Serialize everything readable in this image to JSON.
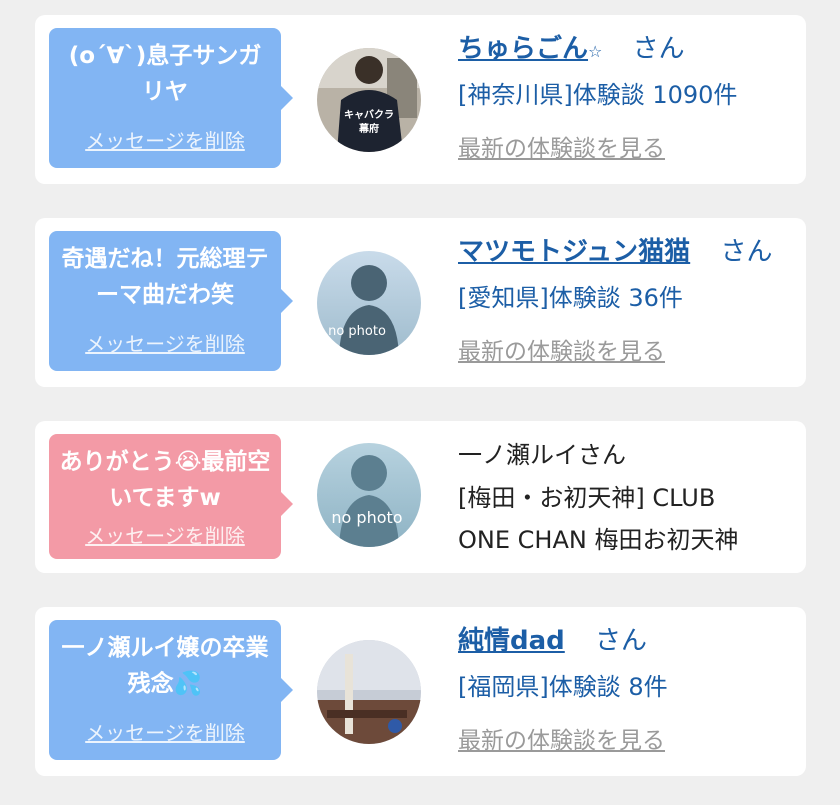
{
  "cards": [
    {
      "bubble_text": "(o´∀`)息子サンガリヤ",
      "delete_label": "メッセージを削除",
      "name": "ちゅらごん",
      "star": "☆",
      "honorific": "さん",
      "area": "[神奈川県]体験談 1090件",
      "latest_label": "最新の体験談を見る",
      "avatar_text": "キャバクラ幕府"
    },
    {
      "bubble_text": "奇遇だね！元総理テーマ曲だわ笑",
      "delete_label": "メッセージを削除",
      "name": "マツモトジュン猫猫",
      "honorific": "さん",
      "area": "[愛知県]体験談 36件",
      "latest_label": "最新の体験談を見る",
      "avatar_text": "no photo"
    },
    {
      "bubble_text": "ありがとう😭最前空いてますw",
      "delete_label": "メッセージを削除",
      "name_plain": "一ノ瀬ルイさん",
      "shop_line1": "[梅田・お初天神] CLUB",
      "shop_line2": "ONE CHAN 梅田お初天神",
      "avatar_text": "no photo"
    },
    {
      "bubble_text": "一ノ瀬ルイ嬢の卒業残念💦",
      "delete_label": "メッセージを削除",
      "name": "純情dad",
      "honorific": "さん",
      "area": "[福岡県]体験談 8件",
      "latest_label": "最新の体験談を見る"
    }
  ],
  "colors": {
    "bubble_blue": "#82b5f3",
    "bubble_pink": "#f39aa6",
    "link": "#1c5ea6"
  }
}
